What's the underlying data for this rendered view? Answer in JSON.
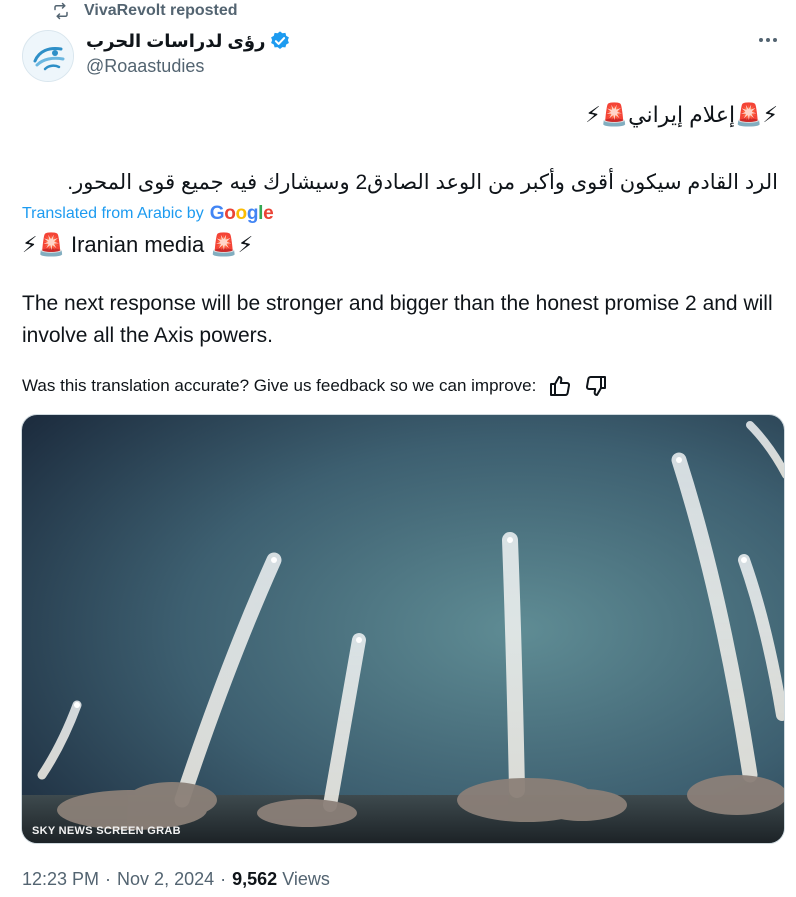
{
  "repost": {
    "label": "VivaRevolt reposted"
  },
  "author": {
    "name": "رؤى لدراسات الحرب",
    "handle": "@Roaastudies",
    "verified": true
  },
  "post": {
    "arabic_title": "⚡🚨إعلام إيراني🚨⚡",
    "arabic_body": "الرد القادم سيكون أقوى وأكبر من الوعد الصادق2 وسيشارك فيه جميع قوى المحور.",
    "translated_label": "Translated from Arabic by",
    "translator": "Google",
    "english_title": "⚡🚨 Iranian media 🚨⚡",
    "english_body": "The next response will be stronger and bigger than the honest promise 2 and will involve all the Axis powers.",
    "feedback_prompt": "Was this translation accurate? Give us feedback so we can improve:"
  },
  "media": {
    "watermark": "SKY NEWS SCREEN GRAB"
  },
  "meta": {
    "time": "12:23 PM",
    "date": "Nov 2, 2024",
    "views_count": "9,562",
    "views_label": "Views",
    "separator": "·"
  },
  "icons": {
    "repost": "repost-icon",
    "verified": "verified-badge-icon",
    "more": "more-options-icon",
    "thumbs_up": "thumbs-up-icon",
    "thumbs_down": "thumbs-down-icon"
  },
  "colors": {
    "accent": "#1d9bf0",
    "secondary_text": "#536471",
    "primary_text": "#0f1419"
  }
}
